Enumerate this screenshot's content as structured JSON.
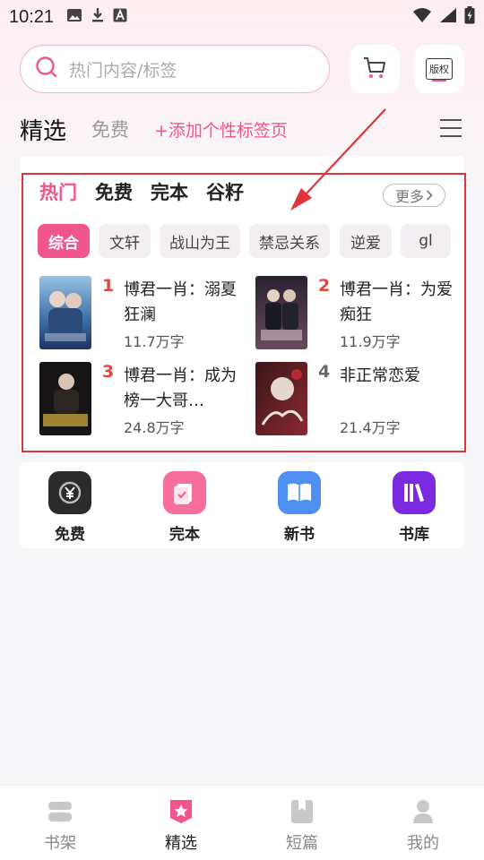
{
  "status_bar": {
    "time": "10:21"
  },
  "search": {
    "placeholder": "热门内容/标签"
  },
  "header_buttons": {
    "copyright_label": "版权"
  },
  "tabs": {
    "main": "精选",
    "free": "免费",
    "add": "+添加个性标签页"
  },
  "categories": [
    {
      "label": "热门",
      "active": true
    },
    {
      "label": "免费",
      "active": false
    },
    {
      "label": "完本",
      "active": false
    },
    {
      "label": "谷籽",
      "active": false
    }
  ],
  "more_label": "更多",
  "chips": [
    {
      "label": "综合",
      "active": true
    },
    {
      "label": "文轩",
      "active": false
    },
    {
      "label": "战山为王",
      "active": false
    },
    {
      "label": "禁忌关系",
      "active": false
    },
    {
      "label": "逆爱",
      "active": false
    },
    {
      "label": "gl",
      "active": false
    }
  ],
  "books": [
    {
      "rank": "1",
      "title": "博君一肖：溺夏狂澜",
      "count": "11.7万字"
    },
    {
      "rank": "2",
      "title": "博君一肖：为爱痴狂",
      "count": "11.9万字"
    },
    {
      "rank": "3",
      "title": "博君一肖：成为榜一大哥…",
      "count": "24.8万字"
    },
    {
      "rank": "4",
      "title": "非正常恋爱",
      "count": "21.4万字"
    }
  ],
  "shortcuts": [
    {
      "label": "免费",
      "color": "#2b2b2b",
      "icon": "yen-icon"
    },
    {
      "label": "完本",
      "color": "#f76e9b",
      "icon": "completed-icon"
    },
    {
      "label": "新书",
      "color": "#4f8ff2",
      "icon": "open-book-icon"
    },
    {
      "label": "书库",
      "color": "#7b2ae0",
      "icon": "library-icon"
    }
  ],
  "bottom_nav": [
    {
      "label": "书架",
      "active": false
    },
    {
      "label": "精选",
      "active": true
    },
    {
      "label": "短篇",
      "active": false
    },
    {
      "label": "我的",
      "active": false
    }
  ],
  "colors": {
    "accent": "#f0568d",
    "annotation": "#e0343a"
  }
}
